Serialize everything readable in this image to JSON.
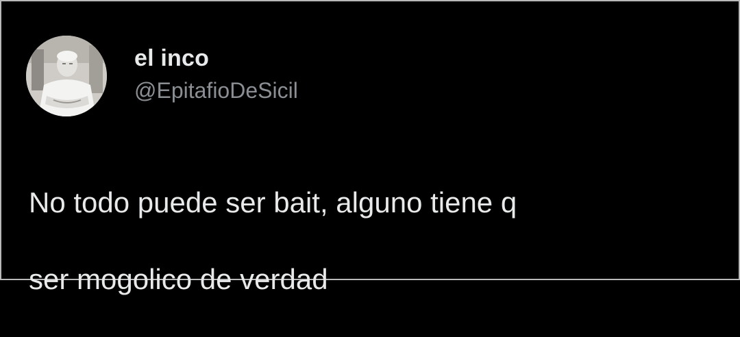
{
  "tweet": {
    "author": {
      "display_name": "el inco",
      "handle": "@EpitafioDeSicil",
      "avatar_icon": "profile-photo"
    },
    "text_line_1": "No todo puede ser bait, alguno tiene q",
    "text_line_2": "ser mogolico de verdad"
  },
  "colors": {
    "background": "#000000",
    "primary_text": "#e7e9ea",
    "secondary_text": "#8b8f93"
  }
}
